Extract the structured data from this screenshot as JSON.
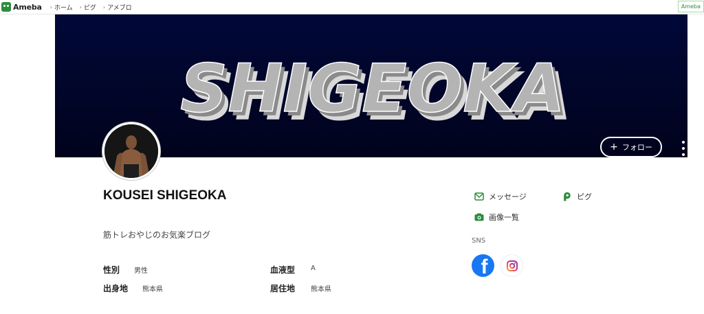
{
  "topbar": {
    "logo_text": "Ameba",
    "nav": [
      {
        "label": "ホーム"
      },
      {
        "label": "ピグ"
      },
      {
        "label": "アメブロ"
      }
    ],
    "right_badge": "Ameba"
  },
  "cover": {
    "banner_text": "SHIGEOKA",
    "follow_label": "フォロー"
  },
  "profile": {
    "name": "KOUSEI SHIGEOKA",
    "description": "筋トレおやじのお気楽ブログ",
    "attributes": {
      "gender_label": "性別",
      "gender_value": "男性",
      "blood_label": "血液型",
      "blood_value": "A",
      "birthplace_label": "出身地",
      "birthplace_value": "熊本県",
      "residence_label": "居住地",
      "residence_value": "熊本県"
    }
  },
  "side": {
    "message_label": "メッセージ",
    "pigg_label": "ピグ",
    "images_label": "画像一覧",
    "sns_label": "SNS"
  },
  "colors": {
    "ameba_green": "#2d8c3c",
    "facebook": "#1877f2",
    "cover_bg": "#010838"
  }
}
